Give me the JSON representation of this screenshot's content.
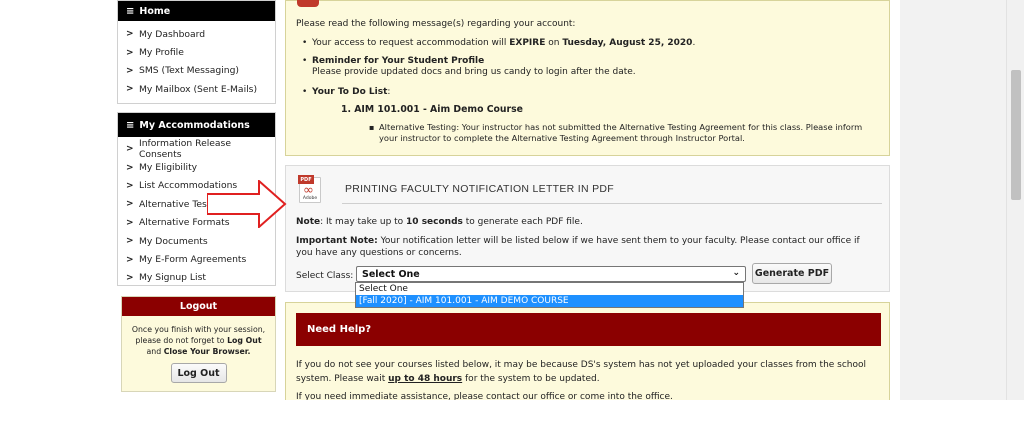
{
  "sidebar": {
    "home": {
      "heading": "Home",
      "items": [
        {
          "label": "My Dashboard"
        },
        {
          "label": "My Profile"
        },
        {
          "label": "SMS (Text Messaging)"
        },
        {
          "label": "My Mailbox (Sent E-Mails)"
        }
      ]
    },
    "accommodations": {
      "heading": "My Accommodations",
      "items": [
        {
          "label": "Information Release Consents"
        },
        {
          "label": "My Eligibility"
        },
        {
          "label": "List Accommodations"
        },
        {
          "label": "Alternative Testing"
        },
        {
          "label": "Alternative Formats"
        },
        {
          "label": "My Documents"
        },
        {
          "label": "My E-Form Agreements"
        },
        {
          "label": "My Signup List"
        }
      ]
    },
    "logout": {
      "heading": "Logout",
      "text_1": "Once you finish with your session,",
      "text_2_pre": "please do not forget to ",
      "text_2_bold": "Log Out",
      "text_3_pre": "and ",
      "text_3_bold": "Close Your Browser",
      "text_3_post": ".",
      "button": "Log Out"
    }
  },
  "messages": {
    "intro": "Please read the following message(s) regarding your account:",
    "expire_pre": "Your access to request accommodation will ",
    "expire_bold": "EXPIRE",
    "expire_mid": " on ",
    "expire_date": "Tuesday, August 25, 2020",
    "expire_post": ".",
    "reminder_title": "Reminder for Your Student Profile",
    "reminder_text": "Please provide updated docs and bring us candy to login after the date.",
    "todo_title": "Your To Do List",
    "todo_colon": ":",
    "todo_course": "1. AIM 101.001 - Aim Demo Course",
    "todo_note": "Alternative Testing: Your instructor has not submitted the Alternative Testing Agreement for this class. Please inform your instructor to complete the Alternative Testing Agreement through Instructor Portal."
  },
  "pdf": {
    "icon_tag": "PDF",
    "icon_brand": "Adobe",
    "title": "PRINTING FACULTY NOTIFICATION LETTER IN PDF",
    "note_label": "Note",
    "note_pre": ": It may take up to ",
    "note_bold": "10 seconds",
    "note_post": " to generate each PDF file.",
    "important_label": "Important Note:",
    "important_text": " Your notification letter will be listed below if we have sent them to your faculty. Please contact our office if you have any questions or concerns.",
    "select_label": "Select Class:",
    "select_value": "Select One",
    "options": [
      "Select One",
      "[Fall 2020] - AIM 101.001 - AIM DEMO COURSE"
    ],
    "highlighted_option": 1,
    "generate_button": "Generate PDF"
  },
  "help": {
    "heading": "Need Help?",
    "text_pre": "If you do not see your courses listed below, it may be because DS's system has not yet uploaded your classes from the school system. Please wait ",
    "text_link": "up to 48 hours",
    "text_post": " for the system to be updated.",
    "more": "If you need immediate assistance, please contact our office or come into the office."
  },
  "colors": {
    "sidebar_header": "#000000",
    "accent_red": "#8b0000",
    "message_bg": "#fdfadc",
    "select_highlight": "#1e90ff",
    "arrow": "#e02020"
  }
}
